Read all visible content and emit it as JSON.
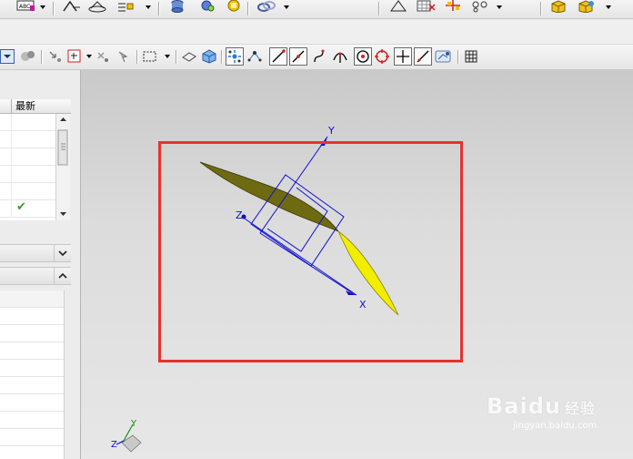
{
  "table": {
    "column_header": "最新",
    "rows": [
      {
        "latest_check": false
      },
      {
        "latest_check": false
      },
      {
        "latest_check": false
      },
      {
        "latest_check": false
      },
      {
        "latest_check": false
      },
      {
        "latest_check": true
      }
    ]
  },
  "axes": {
    "x_label": "X",
    "y_label": "Y",
    "z_label": "Z"
  },
  "triad": {
    "y_label": "Y",
    "z_label": "Z"
  },
  "watermark": {
    "brand": "Baidu",
    "cn": "经验",
    "url": "jingyan.baidu.com"
  },
  "colors": {
    "highlight": "#e53232",
    "axis": "#1010cc",
    "surface_dark": "#6e6a12",
    "surface_light": "#f2ee00"
  },
  "icons": {
    "top_toolbar": [
      "text-abc-icon",
      "sketch-icon",
      "circle-hat-icon",
      "dimension-icon",
      "database-icon",
      "assembly-icon",
      "gold-part-icon",
      "link-icon",
      "triangle-icon",
      "table-grid-icon",
      "grid-plus-icon",
      "grid-points-icon",
      "cube-gold-icon",
      "cube-gold2-icon"
    ],
    "selection_toolbar": [
      "filter-dropdown-icon",
      "part-nav-icon",
      "snap-arrow-icon",
      "point-box-icon",
      "point-icon",
      "arrow-icon",
      "rectangle-select-icon",
      "eraser-icon",
      "cube-blue-icon",
      "point-snap-icon",
      "control-point-icon",
      "line-end-icon",
      "midpoint-icon",
      "curve-icon",
      "intersection-icon",
      "arc-center-icon",
      "quadrant-icon",
      "point-on-curve-icon",
      "point-on-surface-icon",
      "bounded-point-icon",
      "grid-icon"
    ]
  }
}
